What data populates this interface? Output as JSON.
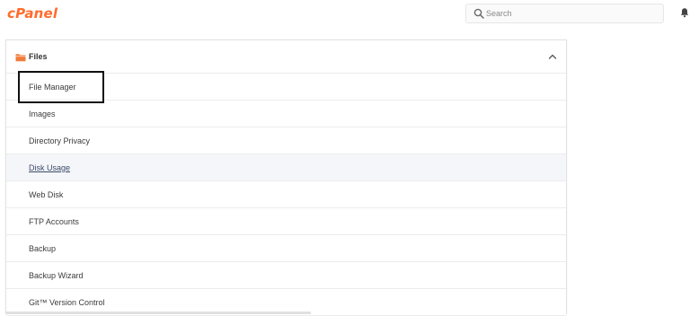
{
  "header": {
    "logo_text": "cPanel",
    "brand_color": "#ff6c2c",
    "search": {
      "placeholder": "Search",
      "value": "",
      "icon": "search-icon"
    },
    "notifications_icon": "bell-icon"
  },
  "files_panel": {
    "title": "Files",
    "icon": "folder-icon",
    "collapse_icon": "chevron-up-icon",
    "items": [
      {
        "label": "File Manager",
        "highlighted": true
      },
      {
        "label": "Images"
      },
      {
        "label": "Directory Privacy"
      },
      {
        "label": "Disk Usage",
        "hovered": true
      },
      {
        "label": "Web Disk"
      },
      {
        "label": "FTP Accounts"
      },
      {
        "label": "Backup"
      },
      {
        "label": "Backup Wizard"
      },
      {
        "label": "Git™ Version Control"
      }
    ]
  }
}
